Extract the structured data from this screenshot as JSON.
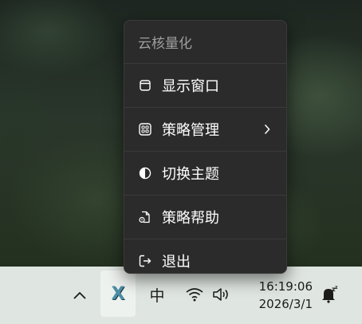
{
  "menu": {
    "title": "云核量化",
    "items": [
      {
        "label": "显示窗口",
        "icon": "window-icon"
      },
      {
        "label": "策略管理",
        "icon": "grid-icon",
        "has_submenu": true
      },
      {
        "label": "切换主题",
        "icon": "theme-contrast-icon"
      },
      {
        "label": "策略帮助",
        "icon": "document-help-icon"
      },
      {
        "label": "退出",
        "icon": "exit-icon"
      }
    ]
  },
  "taskbar": {
    "app_glyph": "X",
    "ime_label": "中",
    "time": "16:19:06",
    "date": "2026/3/1"
  },
  "colors": {
    "menu_bg": "#2b2b2b",
    "menu_title": "#9e9e9e",
    "taskbar_bg": "#dfe5e1",
    "app_accent": "#4d8fa6"
  }
}
